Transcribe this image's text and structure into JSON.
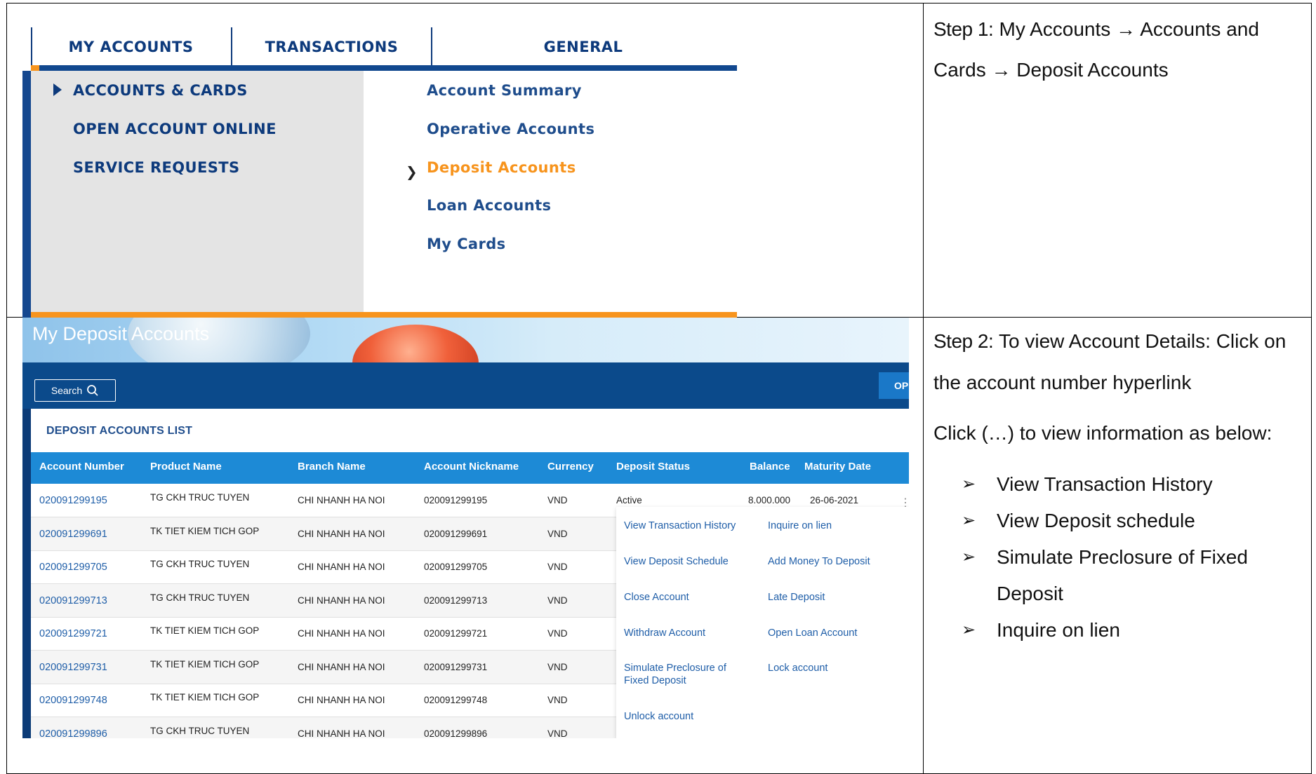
{
  "step1": {
    "label": "Step 1",
    "text": ": My Accounts → Accounts and Cards → Deposit Accounts"
  },
  "step2": {
    "label": "Step 2",
    "text": ":  To view Account Details: Click on the account number hyperlink",
    "click_text": "Click  (…) to view information as below:",
    "bullets": [
      "View Transaction History",
      "View Deposit schedule",
      "Simulate Preclosure of Fixed Deposit",
      "Inquire on lien"
    ]
  },
  "menu": {
    "tabs": [
      "MY ACCOUNTS",
      "TRANSACTIONS",
      "GENERAL"
    ],
    "left_items": [
      "ACCOUNTS & CARDS",
      "OPEN ACCOUNT ONLINE",
      "SERVICE REQUESTS"
    ],
    "right_items": [
      "Account Summary",
      "Operative Accounts",
      "Deposit Accounts",
      "Loan Accounts",
      "My Cards"
    ],
    "active_color": "#f7941d",
    "primary_color": "#0d3a7c"
  },
  "deposit": {
    "title": "My Deposit Accounts",
    "search_label": "Search",
    "open_label": "OPE",
    "list_title": "DEPOSIT ACCOUNTS LIST",
    "headers": [
      "Account Number",
      "Product Name",
      "Branch Name",
      "Account Nickname",
      "Currency",
      "Deposit Status",
      "Balance",
      "Maturity Date"
    ],
    "rows": [
      {
        "acc": "020091299195",
        "product": "TG CKH TRUC TUYEN",
        "branch": "CHI NHANH HA NOI",
        "nick": "020091299195",
        "cur": "VND",
        "status": "Active",
        "balance": "8.000.000",
        "maturity": "26-06-2021"
      },
      {
        "acc": "020091299691",
        "product": "TK TIET KIEM TICH GOP",
        "branch": "CHI NHANH HA NOI",
        "nick": "020091299691",
        "cur": "VND"
      },
      {
        "acc": "020091299705",
        "product": "TG CKH TRUC TUYEN",
        "branch": "CHI NHANH HA NOI",
        "nick": "020091299705",
        "cur": "VND"
      },
      {
        "acc": "020091299713",
        "product": "TG CKH TRUC TUYEN",
        "branch": "CHI NHANH HA NOI",
        "nick": "020091299713",
        "cur": "VND"
      },
      {
        "acc": "020091299721",
        "product": "TK TIET KIEM TICH GOP",
        "branch": "CHI NHANH HA NOI",
        "nick": "020091299721",
        "cur": "VND"
      },
      {
        "acc": "020091299731",
        "product": "TK TIET KIEM TICH GOP",
        "branch": "CHI NHANH HA NOI",
        "nick": "020091299731",
        "cur": "VND"
      },
      {
        "acc": "020091299748",
        "product": "TK TIET KIEM TICH GOP",
        "branch": "CHI NHANH HA NOI",
        "nick": "020091299748",
        "cur": "VND"
      },
      {
        "acc": "020091299896",
        "product": "TG CKH TRUC TUYEN",
        "branch": "CHI NHANH HA NOI",
        "nick": "020091299896",
        "cur": "VND"
      }
    ],
    "popup_left": [
      "View Transaction History",
      "View Deposit Schedule",
      "Close Account",
      "Withdraw Account",
      "Simulate Preclosure of Fixed Deposit",
      "Unlock account"
    ],
    "popup_right": [
      "Inquire on lien",
      "Add Money To Deposit",
      "Late Deposit",
      "Open Loan Account",
      "Lock account"
    ]
  }
}
